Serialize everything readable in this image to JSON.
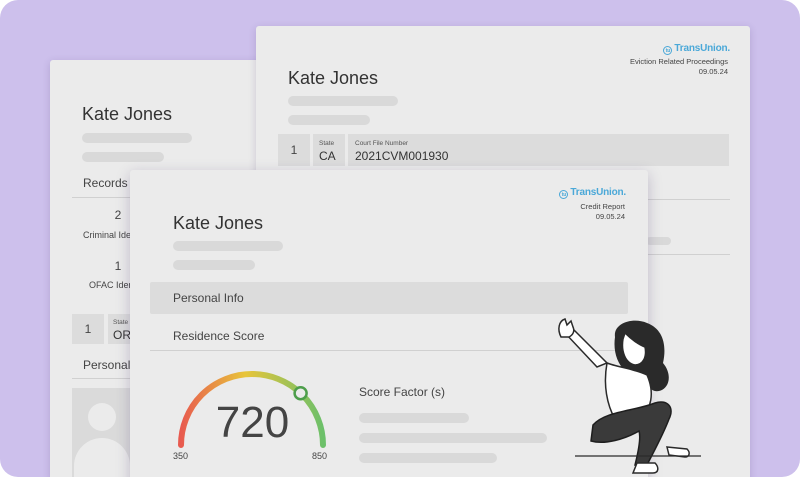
{
  "back_left": {
    "name": "Kate Jones",
    "records_title": "Records",
    "criminal_count": "2",
    "criminal_label": "Criminal Ide",
    "ofac_count": "1",
    "ofac_label": "OFAC Iden",
    "row_index": "1",
    "state_label": "State",
    "state_value": "OR",
    "personal_title": "Personal"
  },
  "back_right": {
    "logo": "TransUnion.",
    "report_type": "Eviction Related Proceedings",
    "date": "09.05.24",
    "name": "Kate Jones",
    "row_index": "1",
    "state_label": "State",
    "state_value": "CA",
    "court_label": "Court File Number",
    "court_value": "2021CVM001930"
  },
  "front": {
    "logo": "TransUnion.",
    "report_type": "Credit Report",
    "date": "09.05.24",
    "name": "Kate Jones",
    "personal_info": "Personal Info",
    "residence_score": "Residence Score",
    "score": "720",
    "score_min": "350",
    "score_max": "850",
    "score_factor": "Score Factor (s)"
  },
  "score_level": 0.74,
  "colors": {
    "background": "#cdc0ec",
    "brand": "#4aa8d8",
    "gauge_low": "#e85a4f",
    "gauge_mid": "#e8c53a",
    "gauge_high": "#6cc06a"
  }
}
